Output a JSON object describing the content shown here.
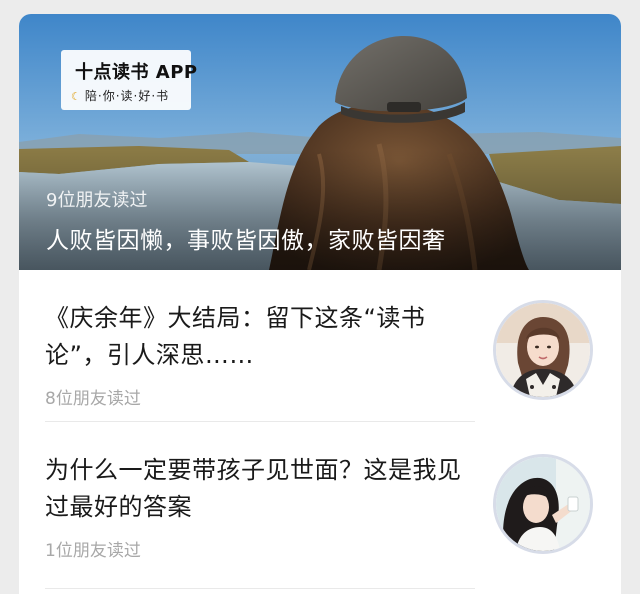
{
  "hero": {
    "brand_name": "十点读书 APP",
    "brand_tagline": "陪·你·读·好·书",
    "readers": "9位朋友读过",
    "title": "人败皆因懒，事败皆因傲，家败皆因奢"
  },
  "articles": [
    {
      "title": "《庆余年》大结局：留下这条“读书论”，引人深思……",
      "readers": "8位朋友读过"
    },
    {
      "title": "为什么一定要带孩子见世面？这是我见过最好的答案",
      "readers": "1位朋友读过"
    }
  ],
  "icons": {
    "brand": "moon-icon"
  },
  "colors": {
    "card_bg": "#ffffff",
    "page_bg": "#ececec",
    "title_text": "#1a1a1a",
    "meta_text": "#a8a8a8",
    "thumb_border": "#d7dce8"
  }
}
